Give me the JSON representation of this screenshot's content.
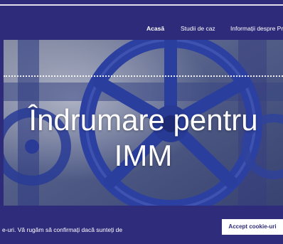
{
  "nav": {
    "items": [
      {
        "label": "Acasă",
        "active": true
      },
      {
        "label": "Studii de caz",
        "active": false
      },
      {
        "label": "Informații despre Pro",
        "active": false
      }
    ]
  },
  "hero": {
    "title_line1": "Îndrumare pentru",
    "title_line2": "IMM"
  },
  "cookie": {
    "text": "e-uri. Vă rugăm să confirmați dacă sunteți de",
    "accept_label": "Accept cookie-uri"
  },
  "colors": {
    "brand": "#2e2c7a",
    "button_bg": "#ffffff",
    "text": "#ffffff"
  }
}
